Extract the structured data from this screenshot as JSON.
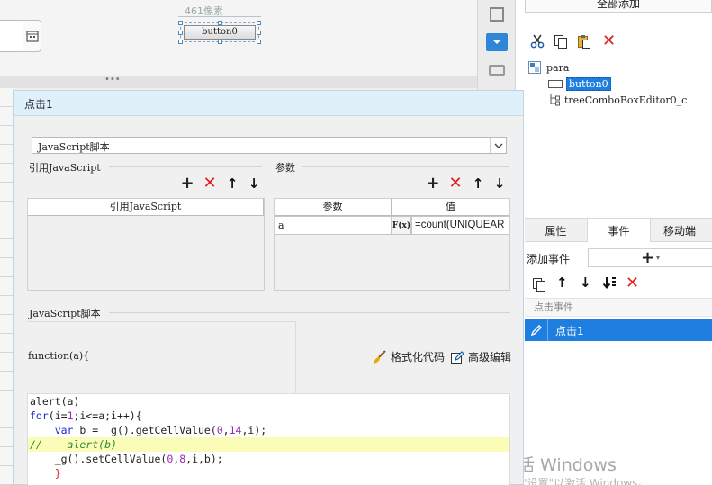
{
  "canvas": {
    "width_label": "461像素",
    "button_label": "button0"
  },
  "right_panel": {
    "add_all_label": "全部添加",
    "tree": {
      "root": "para",
      "children": [
        "button0",
        "treeComboBoxEditor0_c"
      ],
      "selected": "button0"
    },
    "tabs": [
      "属性",
      "事件",
      "移动端"
    ],
    "active_tab": "事件",
    "add_event_label": "添加事件",
    "event_group_label": "点击事件",
    "events": [
      "点击1"
    ]
  },
  "dialog": {
    "title": "点击1",
    "type_select_value": "JavaScript脚本",
    "ref_js_label": "引用JavaScript",
    "ref_js_column": "引用JavaScript",
    "params_label": "参数",
    "params_columns": [
      "参数",
      "值"
    ],
    "params_rows": [
      {
        "name": "a",
        "fx": "F(x)",
        "value": "=count(UNIQUEAR"
      }
    ],
    "js_script_label": "JavaScript脚本",
    "function_header": "function(a){",
    "format_code_label": "格式化代码",
    "advanced_edit_label": "高级编辑",
    "code_lines": [
      [
        {
          "t": "alert(a)",
          "c": ""
        }
      ],
      [
        {
          "t": "for",
          "c": "kw"
        },
        {
          "t": "(i=",
          "c": ""
        },
        {
          "t": "1",
          "c": "num"
        },
        {
          "t": ";i<=a;i++){",
          "c": ""
        }
      ],
      [
        {
          "t": "    ",
          "c": ""
        },
        {
          "t": "var",
          "c": "kw"
        },
        {
          "t": " b = _g().getCellValue(",
          "c": ""
        },
        {
          "t": "0",
          "c": "num"
        },
        {
          "t": ",",
          "c": ""
        },
        {
          "t": "14",
          "c": "num"
        },
        {
          "t": ",i);",
          "c": ""
        }
      ],
      [
        {
          "t": "//    alert(b)",
          "c": "cm"
        }
      ],
      [
        {
          "t": "    _g().setCellValue(",
          "c": ""
        },
        {
          "t": "0",
          "c": "num"
        },
        {
          "t": ",",
          "c": ""
        },
        {
          "t": "8",
          "c": "num"
        },
        {
          "t": ",i,b);",
          "c": ""
        }
      ],
      [
        {
          "t": "    }",
          "c": "xr"
        }
      ]
    ],
    "highlighted_line": 3
  },
  "watermark": {
    "line1": "激活 Windows",
    "line2": "转到\"设置\"以激活 Windows。"
  }
}
